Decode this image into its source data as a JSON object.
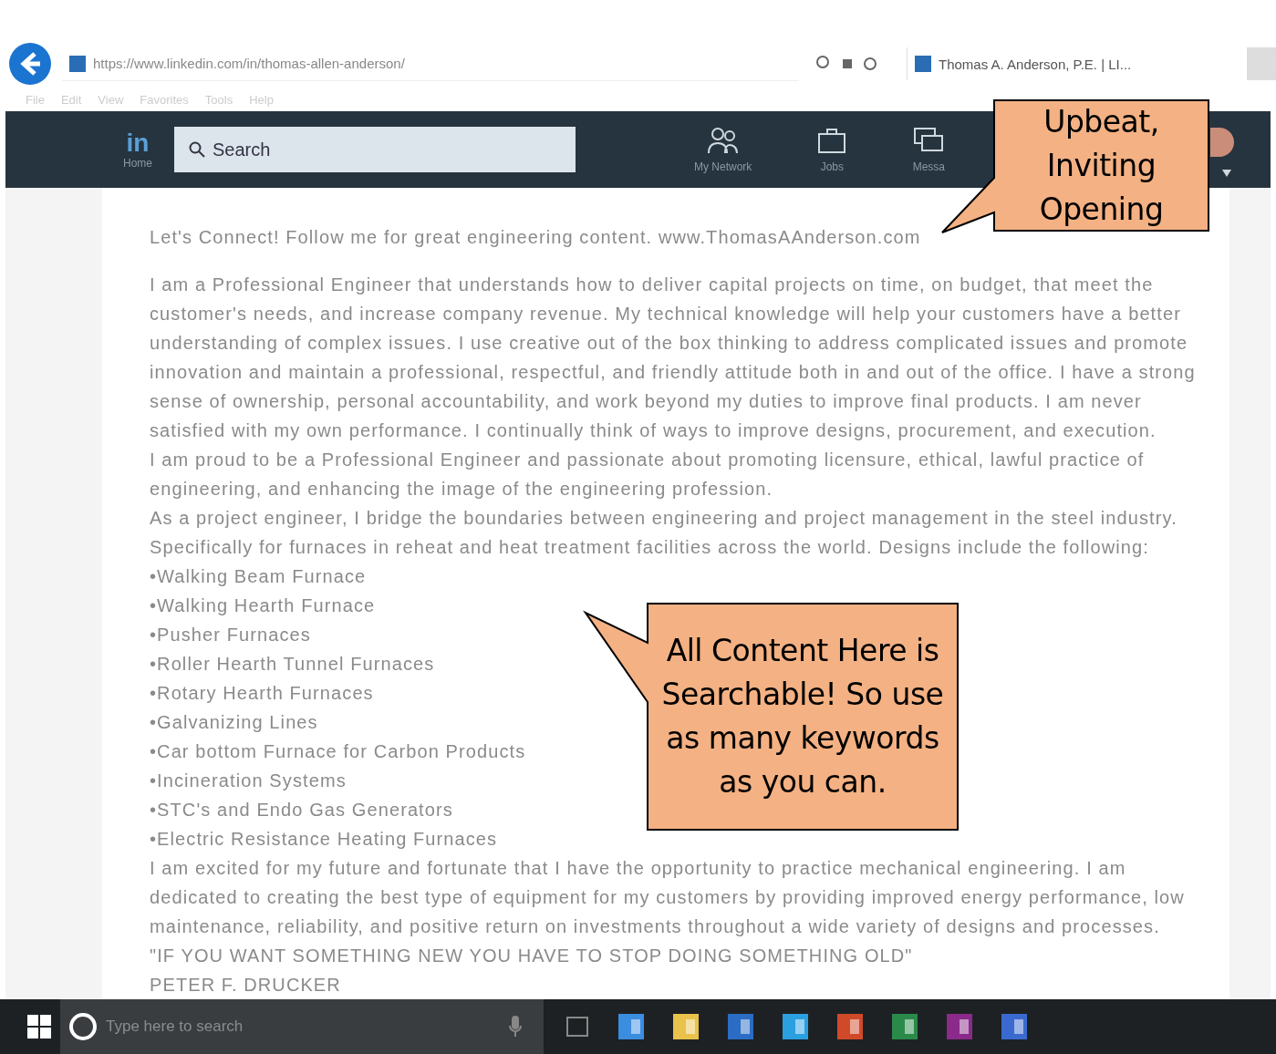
{
  "browser": {
    "url": "https://www.linkedin.com/in/thomas-allen-anderson/",
    "tab_title": "Thomas A. Anderson, P.E. | LI...",
    "menu": [
      "File",
      "Edit",
      "View",
      "Favorites",
      "Tools",
      "Help"
    ]
  },
  "nav": {
    "logo": "in",
    "logo_label": "Home",
    "search_placeholder": "Search",
    "items": [
      {
        "label": "My Network",
        "kind": "network"
      },
      {
        "label": "Jobs",
        "kind": "jobs"
      },
      {
        "label": "Messa",
        "kind": "messaging"
      }
    ]
  },
  "about": [
    {
      "kind": "text",
      "text": "Let's Connect! Follow me for great engineering content. www.ThomasAAnderson.com"
    },
    {
      "kind": "gap"
    },
    {
      "kind": "text",
      "text": "I am a Professional Engineer that understands how to deliver capital projects on time, on budget, that meet the"
    },
    {
      "kind": "text",
      "text": "customer's needs, and increase company revenue. My technical knowledge will help your customers have a better"
    },
    {
      "kind": "text",
      "text": "understanding of complex issues. I use creative out of the box thinking to address complicated issues and promote"
    },
    {
      "kind": "text",
      "text": "innovation and maintain a professional, respectful, and friendly attitude both in and out of the office. I have a strong"
    },
    {
      "kind": "text",
      "text": "sense of ownership, personal accountability, and work beyond my duties to improve final products. I am never"
    },
    {
      "kind": "text",
      "text": "satisfied with my own performance. I continually think of ways to improve designs, procurement, and execution."
    },
    {
      "kind": "text",
      "text": "I am proud to be a Professional Engineer and passionate about promoting licensure, ethical, lawful practice of"
    },
    {
      "kind": "text",
      "text": "engineering, and enhancing the image of the engineering profession."
    },
    {
      "kind": "text",
      "text": "As a project engineer, I bridge the boundaries between engineering and project management in the steel industry."
    },
    {
      "kind": "text",
      "text": "Specifically for furnaces in reheat and heat treatment facilities across the world. Designs include the following:"
    },
    {
      "kind": "text",
      "text": "•Walking Beam Furnace"
    },
    {
      "kind": "text",
      "text": "•Walking Hearth Furnace"
    },
    {
      "kind": "text",
      "text": "•Pusher Furnaces"
    },
    {
      "kind": "text",
      "text": "•Roller Hearth Tunnel Furnaces"
    },
    {
      "kind": "text",
      "text": "•Rotary Hearth Furnaces"
    },
    {
      "kind": "text",
      "text": "•Galvanizing Lines"
    },
    {
      "kind": "text",
      "text": "•Car bottom Furnace for Carbon Products"
    },
    {
      "kind": "text",
      "text": "•Incineration Systems"
    },
    {
      "kind": "text",
      "text": "•STC's and Endo Gas Generators"
    },
    {
      "kind": "text",
      "text": "•Electric Resistance Heating Furnaces"
    },
    {
      "kind": "text",
      "text": "I am excited for my future and fortunate that I have the opportunity to practice mechanical engineering. I am"
    },
    {
      "kind": "text",
      "text": "dedicated to creating the best type of equipment for my customers by providing improved energy performance, low"
    },
    {
      "kind": "text",
      "text": "maintenance, reliability, and positive return on investments throughout a wide variety of designs and processes."
    },
    {
      "kind": "text",
      "text": "\"IF YOU WANT SOMETHING NEW YOU HAVE TO STOP DOING SOMETHING OLD\""
    },
    {
      "kind": "text",
      "text": "PETER F. DRUCKER"
    }
  ],
  "callouts": [
    {
      "kind": "top",
      "text": "Upbeat, Inviting Opening"
    },
    {
      "kind": "middle",
      "text": "All Content Here is Searchable! So use as many keywords as you can."
    }
  ],
  "taskbar": {
    "search_placeholder": "Type here to search"
  }
}
